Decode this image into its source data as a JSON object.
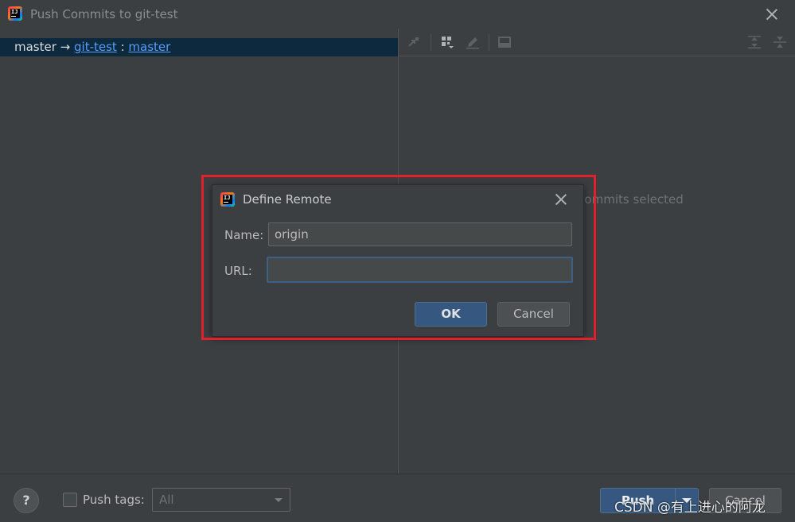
{
  "window": {
    "title": "Push Commits to git-test",
    "logo_text": "IJ"
  },
  "branch": {
    "local": "master",
    "arrow": " → ",
    "remote": "git-test",
    "separator": " : ",
    "remote_branch": "master"
  },
  "details": {
    "empty_text": "No commits selected",
    "toolbar_icons": [
      "cherry-pick-icon",
      "group-by-icon",
      "edit-icon",
      "preview-icon",
      "expand-all-icon",
      "collapse-all-icon"
    ]
  },
  "bottom": {
    "help": "?",
    "push_tags_label": "Push tags:",
    "tags_select_value": "All",
    "push_label": "Push",
    "cancel_label": "Cancel"
  },
  "dialog": {
    "title": "Define Remote",
    "logo_text": "IJ",
    "name_label": "Name:",
    "name_value": "origin",
    "url_label": "URL:",
    "url_value": "",
    "ok_label": "OK",
    "cancel_label": "Cancel"
  },
  "watermark": "CSDN @有上进心的阿龙",
  "colors": {
    "background": "#3c3f41",
    "selection": "#0d293e",
    "link": "#589df6",
    "primary_button": "#365880",
    "highlight_border": "#e0202a"
  }
}
